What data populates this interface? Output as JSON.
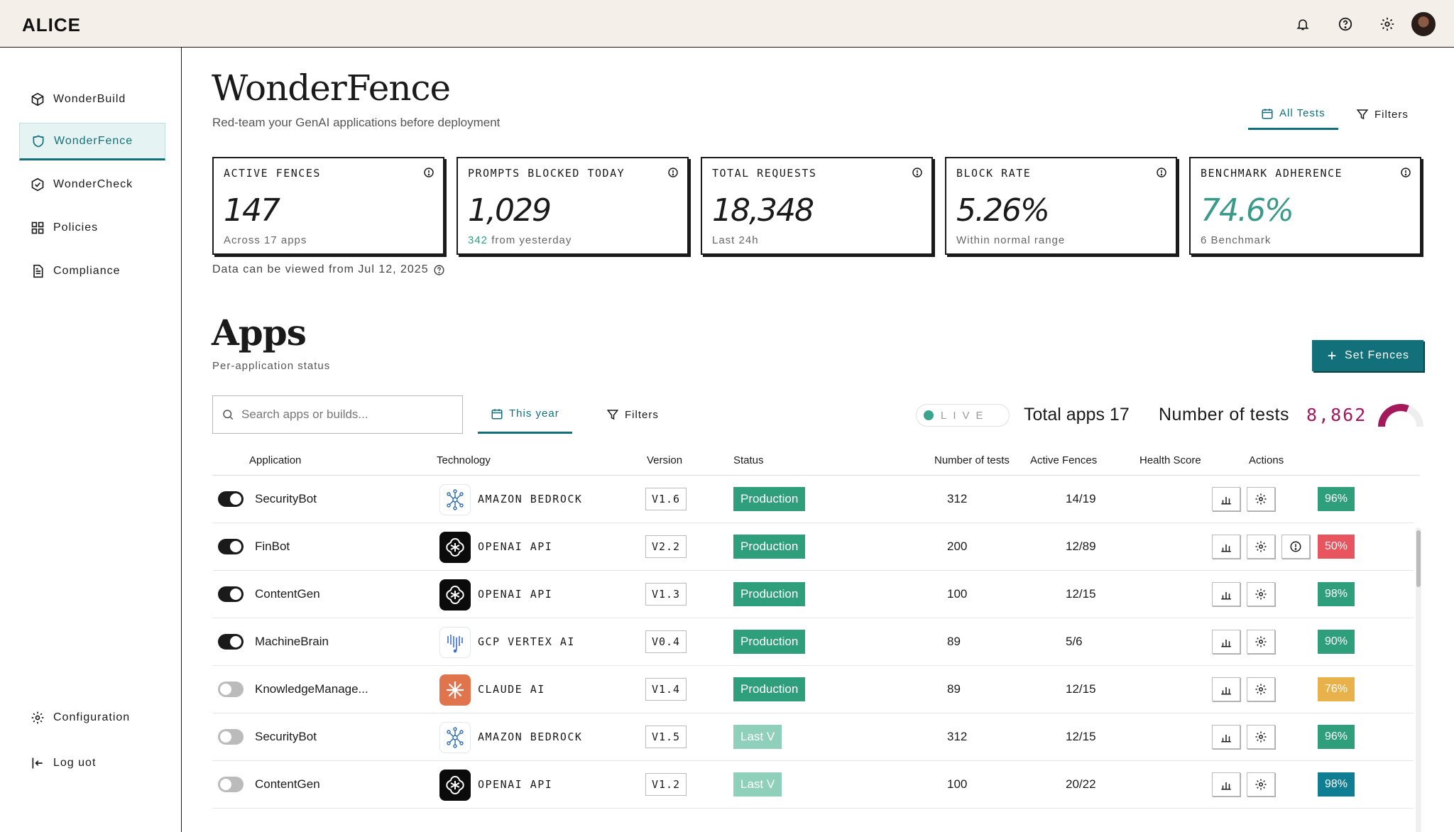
{
  "app": {
    "logo": "ALICE"
  },
  "topbar": {
    "icons": [
      "bell-icon",
      "help-icon",
      "gear-icon",
      "avatar"
    ]
  },
  "sidebar": {
    "items": [
      {
        "label": "WonderBuild",
        "icon": "cube-icon",
        "active": false
      },
      {
        "label": "WonderFence",
        "icon": "shield-icon",
        "active": true
      },
      {
        "label": "WonderCheck",
        "icon": "check-cube-icon",
        "active": false
      },
      {
        "label": "Policies",
        "icon": "grid-icon",
        "active": false
      },
      {
        "label": "Compliance",
        "icon": "document-icon",
        "active": false
      }
    ],
    "bottom": [
      {
        "label": "Configuration",
        "icon": "gear-icon"
      },
      {
        "label": "Log uot",
        "icon": "logout-icon"
      }
    ]
  },
  "header": {
    "title": "WonderFence",
    "subtitle": "Red-team your GenAI applications before deployment",
    "tabs": [
      {
        "label": "All Tests",
        "icon": "calendar-icon",
        "active": true
      },
      {
        "label": "Filters",
        "icon": "filter-icon",
        "active": false
      }
    ]
  },
  "kpis": [
    {
      "label": "ACTIVE FENCES",
      "value": "147",
      "sub": "Across 17 apps",
      "sub_highlight": ""
    },
    {
      "label": "PROMPTS BLOCKED TODAY",
      "value": "1,029",
      "sub": "from yesterday",
      "sub_highlight": "342"
    },
    {
      "label": "TOTAL REQUESTS",
      "value": "18,348",
      "sub": "Last 24h",
      "sub_highlight": ""
    },
    {
      "label": "BLOCK RATE",
      "value": "5.26%",
      "sub": "Within normal range",
      "sub_highlight": ""
    },
    {
      "label": "BENCHMARK ADHERENCE",
      "value": "74.6%",
      "sub": "6 Benchmark",
      "sub_highlight": ""
    }
  ],
  "data_note": "Data can be viewed from Jul 12, 2025",
  "apps": {
    "title": "Apps",
    "subtitle": "Per-application status",
    "set_fences_label": "Set Fences",
    "search_placeholder": "Search apps or builds...",
    "period_label": "This year",
    "filters_label": "Filters",
    "live_label": "LIVE",
    "total_apps_label": "Total apps 17",
    "num_tests_label": "Number of tests",
    "num_tests_value": "8,862",
    "gauge_fraction": 0.62,
    "colors": {
      "accent": "#11707a",
      "production": "#2e9e7b",
      "magenta": "#a3195b"
    }
  },
  "table": {
    "headers": [
      "Application",
      "Technology",
      "Version",
      "Status",
      "Number of tests",
      "Active Fences",
      "Health Score",
      "Actions"
    ],
    "rows": [
      {
        "enabled": true,
        "name": "SecurityBot",
        "tech": "AMAZON BEDROCK",
        "tech_logo": "aws",
        "version": "V1.6",
        "status": "Production",
        "status_type": "prod",
        "tests": "312",
        "fences": "14/19",
        "health": "96%",
        "health_color": "green",
        "alert": false
      },
      {
        "enabled": true,
        "name": "FinBot",
        "tech": "OPENAI API",
        "tech_logo": "openai",
        "version": "V2.2",
        "status": "Production",
        "status_type": "prod",
        "tests": "200",
        "fences": "12/89",
        "health": "50%",
        "health_color": "red",
        "alert": true
      },
      {
        "enabled": true,
        "name": "ContentGen",
        "tech": "OPENAI API",
        "tech_logo": "openai",
        "version": "V1.3",
        "status": "Production",
        "status_type": "prod",
        "tests": "100",
        "fences": "12/15",
        "health": "98%",
        "health_color": "green",
        "alert": false
      },
      {
        "enabled": true,
        "name": "MachineBrain",
        "tech": "GCP VERTEX AI",
        "tech_logo": "gcp",
        "version": "V0.4",
        "status": "Production",
        "status_type": "prod",
        "tests": "89",
        "fences": "5/6",
        "health": "90%",
        "health_color": "green",
        "alert": false
      },
      {
        "enabled": false,
        "name": "KnowledgeManage...",
        "tech": "CLAUDE AI",
        "tech_logo": "claude",
        "version": "V1.4",
        "status": "Production",
        "status_type": "prod",
        "tests": "89",
        "fences": "12/15",
        "health": "76%",
        "health_color": "amber",
        "alert": false
      },
      {
        "enabled": false,
        "name": "SecurityBot",
        "tech": "AMAZON BEDROCK",
        "tech_logo": "aws",
        "version": "V1.5",
        "status": "Last V",
        "status_type": "last",
        "tests": "312",
        "fences": "12/15",
        "health": "96%",
        "health_color": "green",
        "alert": false
      },
      {
        "enabled": false,
        "name": "ContentGen",
        "tech": "OPENAI API",
        "tech_logo": "openai",
        "version": "V1.2",
        "status": "Last V",
        "status_type": "last",
        "tests": "100",
        "fences": "20/22",
        "health": "98%",
        "health_color": "teal",
        "alert": false
      }
    ]
  }
}
